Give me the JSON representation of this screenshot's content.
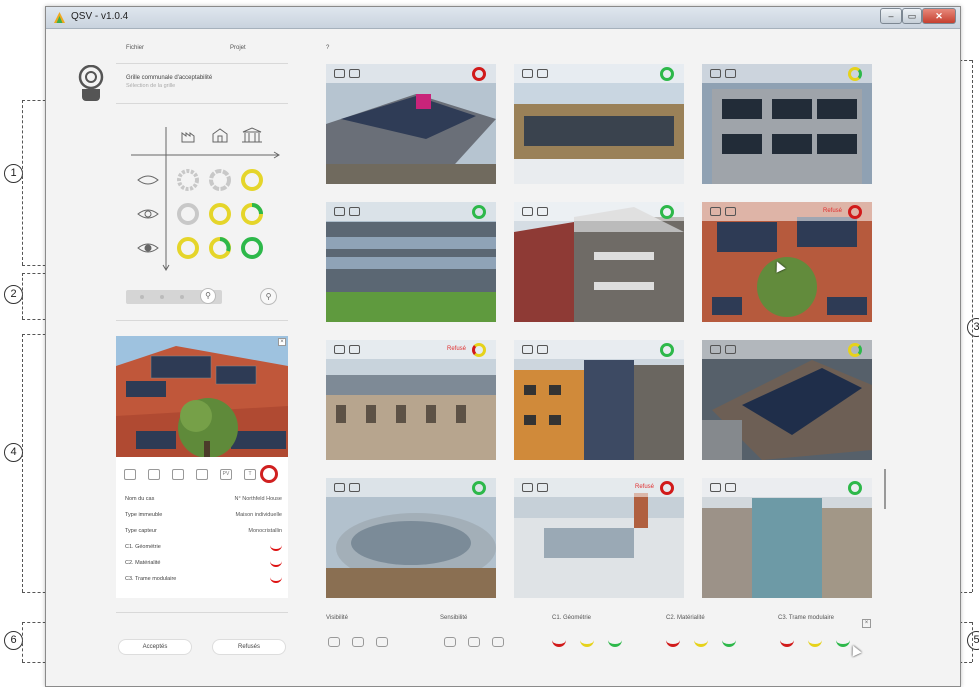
{
  "window": {
    "title": "QSV - v1.0.4",
    "controls": [
      "–",
      "▭",
      "✕"
    ]
  },
  "menu": [
    "Fichier",
    "Projet",
    "?"
  ],
  "left_panel": {
    "grid_title": "Grille communale d'acceptabilité",
    "grid_subtitle": "Sélection de la grille"
  },
  "detail_card": {
    "rows": [
      {
        "key": "Nom du cas",
        "value": "N° Northfeld House"
      },
      {
        "key": "Type immeuble",
        "value": "Maison individuelle"
      },
      {
        "key": "Type capteur",
        "value": "Monocristallin"
      },
      {
        "key": "C1. Géométrie",
        "value": ""
      },
      {
        "key": "C2. Matérialité",
        "value": ""
      },
      {
        "key": "C3. Trame modulaire",
        "value": ""
      }
    ],
    "icon_labels": [
      "PV",
      "T"
    ]
  },
  "buttons": {
    "accept": "Acceptés",
    "refuse": "Refusés"
  },
  "tiles": [
    {
      "status": "refused-red",
      "label": ""
    },
    {
      "status": "accepted",
      "label": ""
    },
    {
      "status": "partial",
      "label": ""
    },
    {
      "status": "accepted",
      "label": ""
    },
    {
      "status": "accepted",
      "label": ""
    },
    {
      "status": "refused-red",
      "label": "Refusé"
    },
    {
      "status": "partial-red",
      "label": "Refusé"
    },
    {
      "status": "accepted",
      "label": ""
    },
    {
      "status": "partial",
      "label": ""
    },
    {
      "status": "accepted",
      "label": ""
    },
    {
      "status": "refused-red",
      "label": "Refusé"
    },
    {
      "status": "accepted",
      "label": ""
    }
  ],
  "filters": {
    "labels": [
      "Visibilité",
      "Sensibilité",
      "C1. Géométrie",
      "C2. Matérialité",
      "C3. Trame modulaire"
    ]
  },
  "callouts": [
    "1",
    "2",
    "3",
    "4",
    "5",
    "6"
  ],
  "colors": {
    "accept": "#2db84a",
    "refuse": "#d11a1a",
    "partial": "#e6d21a"
  }
}
